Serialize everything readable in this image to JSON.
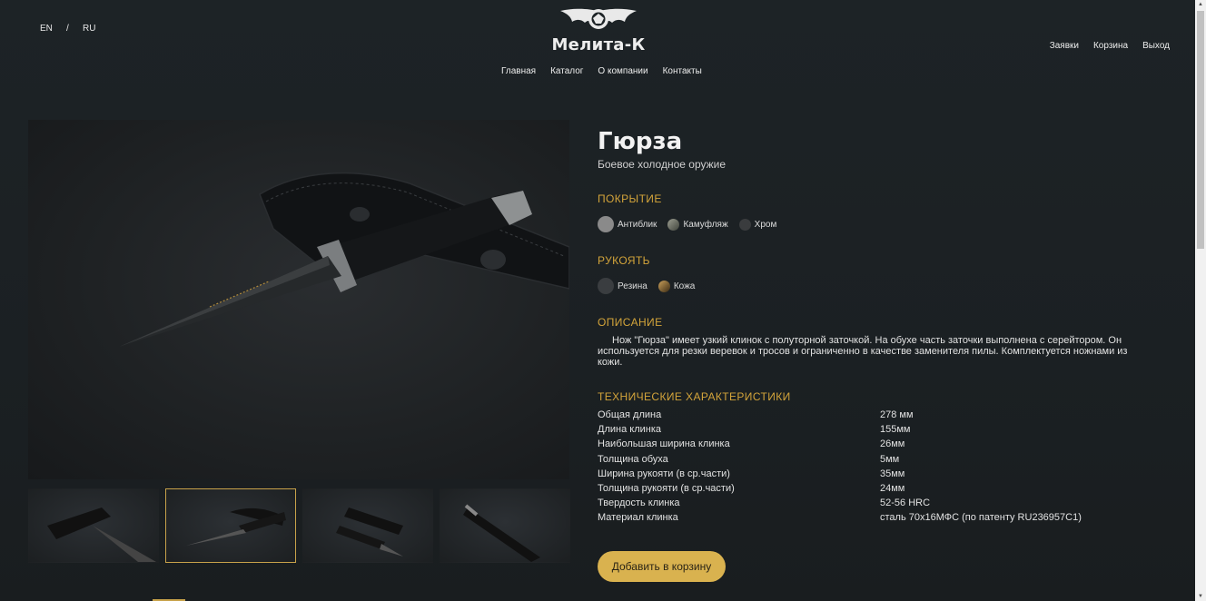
{
  "lang": {
    "en": "EN",
    "separator": "/",
    "ru": "RU"
  },
  "logo": {
    "brand": "Мелита-К",
    "icon": "bat-wings-emblem-icon"
  },
  "nav": [
    "Главная",
    "Каталог",
    "О компании",
    "Контакты"
  ],
  "user_nav": [
    "Заявки",
    "Корзина",
    "Выход"
  ],
  "product": {
    "title": "Гюрза",
    "subtitle": "Боевое холодное оружие",
    "coating": {
      "heading": "ПОКРЫТИЕ",
      "options": [
        {
          "label": "Антиблик",
          "color": "#8a8a8a",
          "selected": true
        },
        {
          "label": "Камуфляж",
          "color": "#6b6e62",
          "selected": false
        },
        {
          "label": "Хром",
          "color": "#3a3c3e",
          "selected": false
        }
      ]
    },
    "handle": {
      "heading": "РУКОЯТЬ",
      "options": [
        {
          "label": "Резина",
          "color": "#3a3d40",
          "selected": true
        },
        {
          "label": "Кожа",
          "color": "#a07a3a",
          "selected": false
        }
      ]
    },
    "description": {
      "heading": "ОПИСАНИЕ",
      "text": "Нож \"Гюрза\" имеет узкий клинок с полуторной заточкой. На обухе часть заточки выполнена с серейтором. Он используется для резки веревок и тросов и ограниченно в качестве заменителя пилы. Комплектуется ножнами из кожи."
    },
    "specs": {
      "heading": "ТЕХНИЧЕСКИЕ ХАРАКТЕРИСТИКИ",
      "rows": [
        {
          "k": "Общая длина",
          "v": "278 мм"
        },
        {
          "k": "Длина клинка",
          "v": "155мм"
        },
        {
          "k": "Наибольшая ширина клинка",
          "v": "26мм"
        },
        {
          "k": "Толщина обуха",
          "v": "5мм"
        },
        {
          "k": "Ширина рукояти (в ср.части)",
          "v": "35мм"
        },
        {
          "k": "Толщина рукояти (в ср.части)",
          "v": "24мм"
        },
        {
          "k": "Твердость клинка",
          "v": "52-56 HRC"
        },
        {
          "k": "Материал клинка",
          "v": "сталь 70х16МФС (по патенту RU236957C1)"
        }
      ]
    },
    "add_to_cart": "Добавить в корзину",
    "gallery": {
      "active_thumb": 2,
      "thumb_count": 4
    }
  },
  "colors": {
    "accent": "#d3a43a",
    "button": "#d9b24f",
    "background": "#1c2124"
  }
}
